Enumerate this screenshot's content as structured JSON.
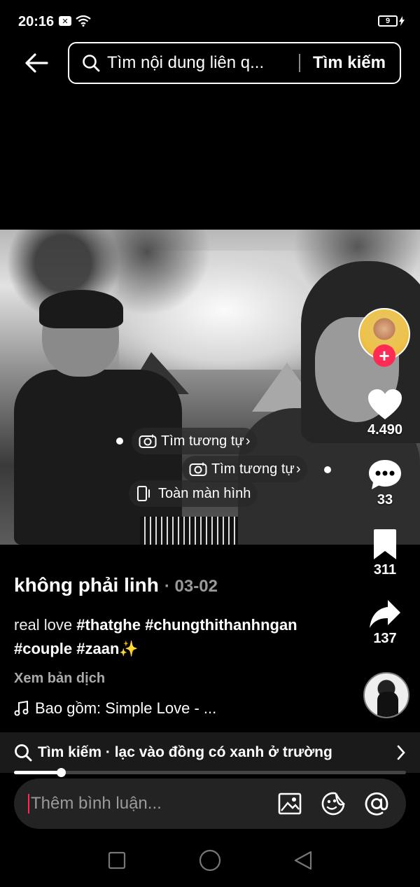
{
  "status_bar": {
    "time": "20:16",
    "battery": "9"
  },
  "header": {
    "search_placeholder": "Tìm nội dung liên q...",
    "search_button": "Tìm kiếm"
  },
  "video": {
    "overlays": {
      "find_similar_1": "Tìm tương tự",
      "find_similar_2": "Tìm tương tự",
      "fullscreen": "Toàn màn hình"
    }
  },
  "actions": {
    "likes": "4.490",
    "comments": "33",
    "bookmarks": "311",
    "shares": "137"
  },
  "post": {
    "author": "không phải linh",
    "date": "· 03-02",
    "caption_prefix": "real love ",
    "hashtags": [
      "#thatghe",
      "#chungthithanhngan",
      "#couple",
      "#zaan"
    ],
    "caption_emoji": "✨",
    "translate": "Xem bản dịch",
    "music": "Bao gồm: Simple Love - ..."
  },
  "search_suggestion": {
    "text": "Tìm kiếm · lạc vào đồng có xanh ở trường"
  },
  "progress": {
    "value": 0.12
  },
  "comment_bar": {
    "placeholder": "Thêm bình luận..."
  },
  "icons": {
    "back": "arrow-left-icon",
    "search": "search-icon",
    "camera": "camera-search-icon",
    "fullscreen": "fullscreen-icon",
    "heart": "heart-icon",
    "comment": "comment-icon",
    "bookmark": "bookmark-icon",
    "share": "share-icon",
    "music": "music-note-icon",
    "image": "image-icon",
    "emoji": "emoji-icon",
    "mention": "at-icon"
  },
  "colors": {
    "accent": "#fe2c55",
    "background": "#000000"
  }
}
